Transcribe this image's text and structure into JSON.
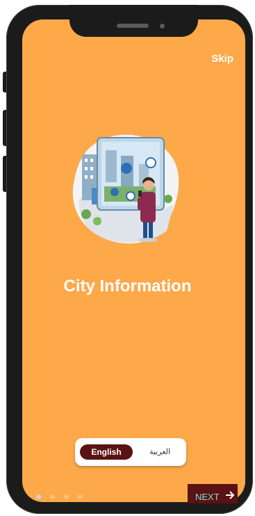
{
  "header": {
    "skip_label": "Skip"
  },
  "onboarding": {
    "title": "City Information",
    "illustration_icon": "city-information-illustration"
  },
  "language_toggle": {
    "options": [
      {
        "label": "English",
        "selected": true
      },
      {
        "label": "العربية",
        "selected": false
      }
    ]
  },
  "pager": {
    "total_pages": 4,
    "current_page": 1
  },
  "footer": {
    "next_label": "NEXT",
    "next_icon": "arrow-right-icon"
  },
  "colors": {
    "background": "#fda94a",
    "accent": "#5a1212",
    "next_text": "#7fdde0",
    "dot_active": "#d0d0d0",
    "dot_inactive": "#f3c27e"
  }
}
